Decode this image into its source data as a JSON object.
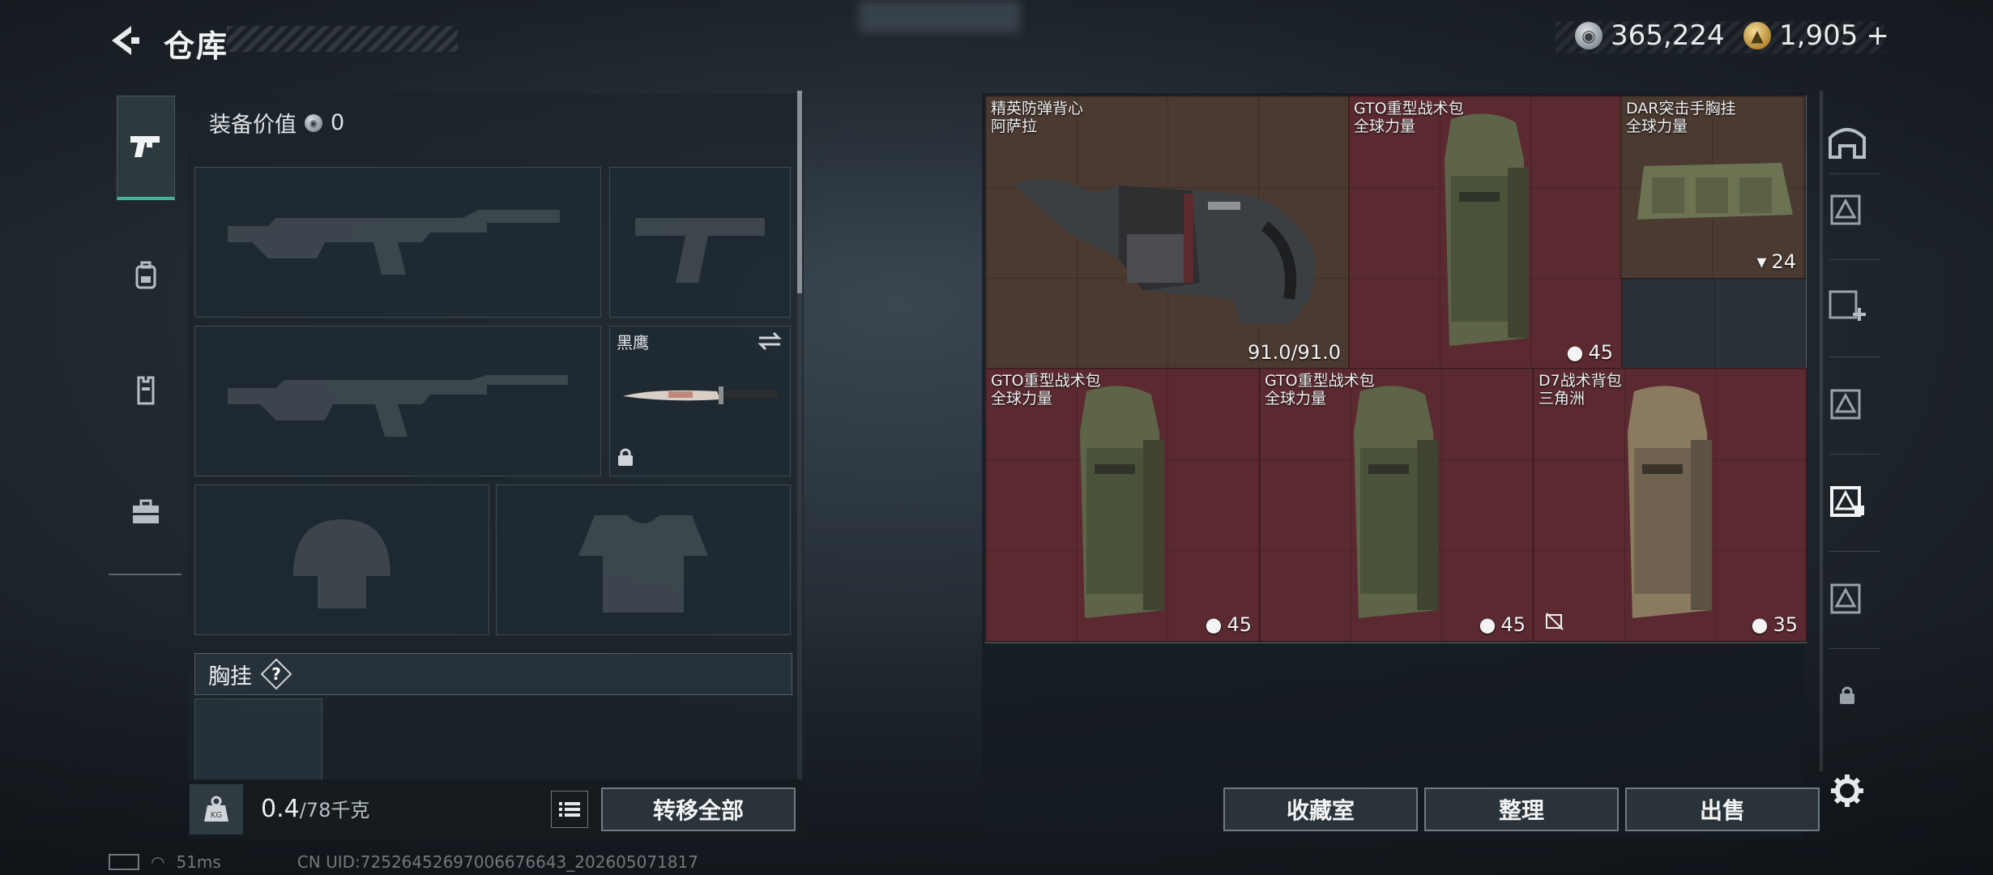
{
  "header": {
    "title": "仓库",
    "currency": [
      {
        "icon": "silver-coin-icon",
        "value": "365,224"
      },
      {
        "icon": "gold-coin-icon",
        "value": "1,905",
        "suffix": "+"
      }
    ]
  },
  "tabs": [
    {
      "name": "pistol-icon",
      "active": true
    },
    {
      "name": "backpack-icon",
      "active": false
    },
    {
      "name": "vest-icon",
      "active": false
    },
    {
      "name": "medkit-icon",
      "active": false
    }
  ],
  "equipment": {
    "value_label": "装备价值",
    "value": "0",
    "melee": {
      "label": "黑鹰"
    },
    "chest_rig_label": "胸挂",
    "help": "?"
  },
  "weight": {
    "current": "0.4",
    "max": "/78千克"
  },
  "buttons": {
    "transfer_all": "转移全部",
    "collection": "收藏室",
    "organize": "整理",
    "sell": "出售"
  },
  "storage_items": [
    {
      "name": "精英防弹背心",
      "sub": "阿萨拉",
      "stat": "91.0/91.0",
      "tint": "brown"
    },
    {
      "name": "GTO重型战术包",
      "sub": "全球力量",
      "stat": "45",
      "tint": "red"
    },
    {
      "name": "DAR突击手胸挂",
      "sub": "全球力量",
      "stat": "24",
      "tint": "brown"
    },
    {
      "name": "GTO重型战术包",
      "sub": "全球力量",
      "stat": "45",
      "tint": "red"
    },
    {
      "name": "GTO重型战术包",
      "sub": "全球力量",
      "stat": "45",
      "tint": "red"
    },
    {
      "name": "D7战术背包",
      "sub": "三角洲",
      "stat": "35",
      "tint": "red"
    }
  ],
  "status_bar": {
    "ping": "51ms",
    "uid": "CN UID:7252645269700667664​3_202605071817"
  },
  "colors": {
    "accent": "#3fb593",
    "item_red": "#5a2a30",
    "item_brown": "#4a3a31"
  }
}
